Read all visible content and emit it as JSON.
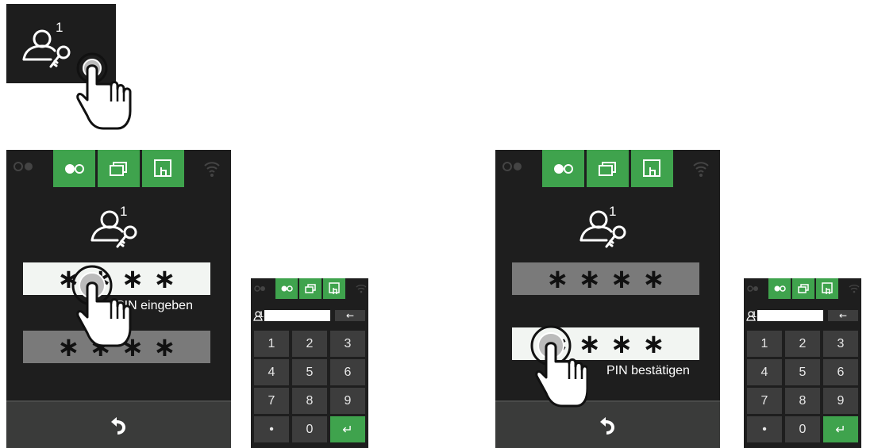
{
  "top_icon": {
    "icon": "user-key-icon",
    "badge": "1"
  },
  "screen_left": {
    "tabs": [
      {
        "icon": "tape-icon"
      },
      {
        "icon": "layers-icon"
      },
      {
        "icon": "touch-icon"
      }
    ],
    "user_badge": "1",
    "pin_fields": [
      {
        "value": "∗ ∗ ∗ ∗",
        "state": "active"
      },
      {
        "value": "∗ ∗ ∗ ∗",
        "state": "inactive"
      }
    ],
    "caption": "PIN eingeben",
    "back_icon": "return-arrow-icon"
  },
  "screen_right": {
    "tabs": [
      {
        "icon": "tape-icon"
      },
      {
        "icon": "layers-icon"
      },
      {
        "icon": "touch-icon"
      }
    ],
    "user_badge": "1",
    "pin_fields": [
      {
        "value": "∗ ∗ ∗ ∗",
        "state": "inactive"
      },
      {
        "value": "∗ ∗ ∗ ∗",
        "state": "active"
      }
    ],
    "caption": "PIN bestätigen",
    "back_icon": "return-arrow-icon"
  },
  "keypad": {
    "user_label": "1",
    "backspace": "←",
    "keys": [
      "1",
      "2",
      "3",
      "4",
      "5",
      "6",
      "7",
      "8",
      "9",
      "•",
      "0",
      "↵"
    ]
  },
  "colors": {
    "accent": "#3fa34d",
    "screen_bg": "#1e1e1e",
    "key_bg": "#3d3d3d"
  }
}
